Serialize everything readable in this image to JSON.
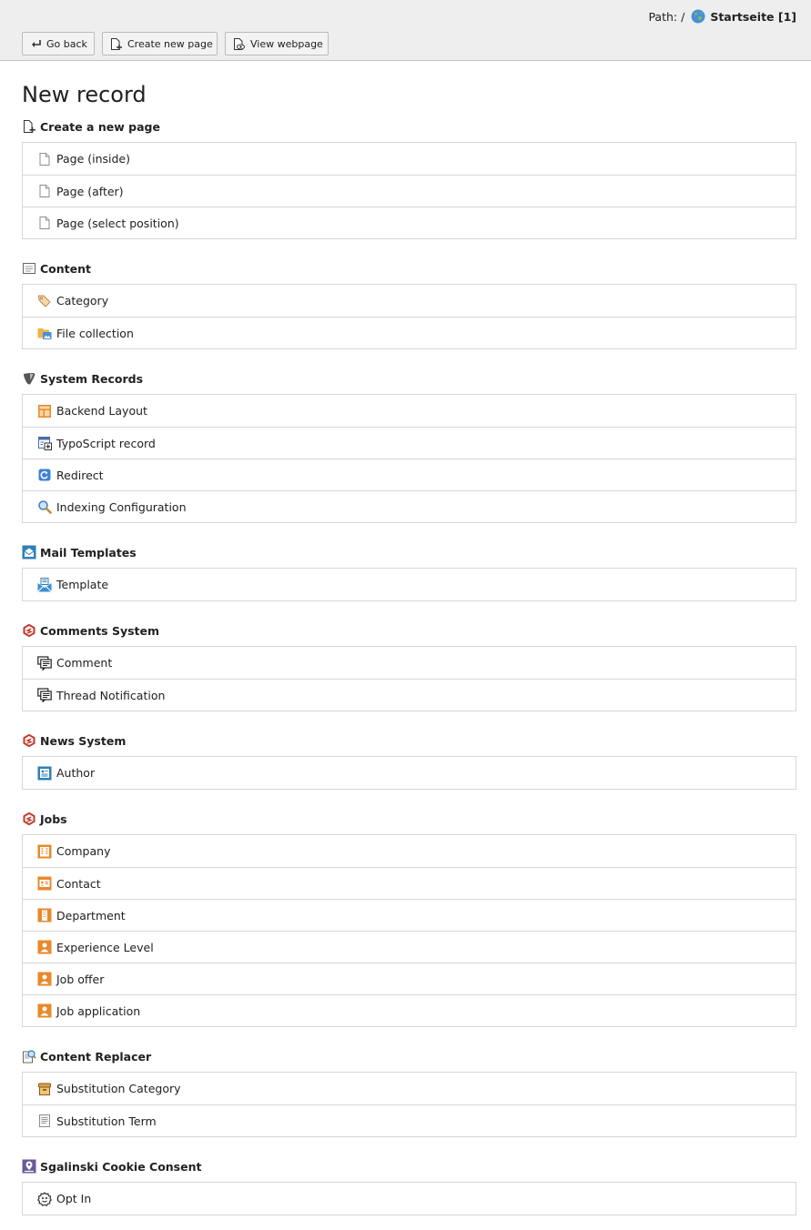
{
  "header": {
    "path_label": "Path: /",
    "page_name": "Startseite [1]",
    "buttons": [
      {
        "label": "Go back",
        "icon": "return-icon"
      },
      {
        "label": "Create new page",
        "icon": "new-page-icon"
      },
      {
        "label": "View webpage",
        "icon": "view-page-icon"
      }
    ]
  },
  "title": "New record",
  "sections": [
    {
      "title": "Create a new page",
      "icon": "new-page-icon",
      "items": [
        {
          "label": "Page (inside)",
          "icon": "page-icon"
        },
        {
          "label": "Page (after)",
          "icon": "page-icon"
        },
        {
          "label": "Page (select position)",
          "icon": "page-icon"
        }
      ]
    },
    {
      "title": "Content",
      "icon": "content-icon",
      "items": [
        {
          "label": "Category",
          "icon": "tag-icon"
        },
        {
          "label": "File collection",
          "icon": "folder-image-icon"
        }
      ]
    },
    {
      "title": "System Records",
      "icon": "typo3-icon",
      "items": [
        {
          "label": "Backend Layout",
          "icon": "layout-icon"
        },
        {
          "label": "TypoScript record",
          "icon": "typoscript-icon"
        },
        {
          "label": "Redirect",
          "icon": "redirect-icon"
        },
        {
          "label": "Indexing Configuration",
          "icon": "magnifier-icon"
        }
      ]
    },
    {
      "title": "Mail Templates",
      "icon": "mail-template-icon",
      "items": [
        {
          "label": "Template",
          "icon": "envelope-icon"
        }
      ]
    },
    {
      "title": "Comments System",
      "icon": "sgalinski-icon",
      "items": [
        {
          "label": "Comment",
          "icon": "comments-icon"
        },
        {
          "label": "Thread Notification",
          "icon": "comments-icon"
        }
      ]
    },
    {
      "title": "News System",
      "icon": "sgalinski-icon",
      "items": [
        {
          "label": "Author",
          "icon": "author-icon"
        }
      ]
    },
    {
      "title": "Jobs",
      "icon": "sgalinski-icon",
      "items": [
        {
          "label": "Company",
          "icon": "company-icon"
        },
        {
          "label": "Contact",
          "icon": "contact-icon"
        },
        {
          "label": "Department",
          "icon": "department-icon"
        },
        {
          "label": "Experience Level",
          "icon": "person-icon"
        },
        {
          "label": "Job offer",
          "icon": "person-icon"
        },
        {
          "label": "Job application",
          "icon": "person-icon"
        }
      ]
    },
    {
      "title": "Content Replacer",
      "icon": "content-replacer-icon",
      "items": [
        {
          "label": "Substitution Category",
          "icon": "archive-icon"
        },
        {
          "label": "Substitution Term",
          "icon": "document-icon"
        }
      ]
    },
    {
      "title": "Sgalinski Cookie Consent",
      "icon": "cookie-consent-icon",
      "items": [
        {
          "label": "Opt In",
          "icon": "cookie-icon"
        }
      ]
    }
  ]
}
